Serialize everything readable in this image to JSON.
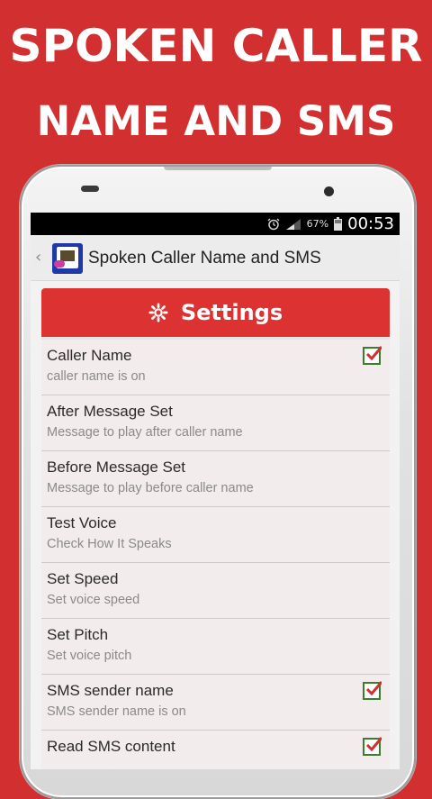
{
  "promo": {
    "line1": "SPOKEN CALLER",
    "line2": "NAME AND SMS"
  },
  "status_bar": {
    "battery_percent": "67%",
    "time": "00:53",
    "icons": [
      "alarm-icon",
      "signal-icon",
      "battery-icon"
    ]
  },
  "action_bar": {
    "back_icon": "chevron-left-icon",
    "title": "Spoken Caller Name and SMS"
  },
  "settings": {
    "header_icon": "gear-icon",
    "title": "Settings",
    "items": [
      {
        "title": "Caller Name",
        "summary": "caller name is on",
        "checked": true
      },
      {
        "title": "After Message Set",
        "summary": "Message to play after caller name",
        "checked": false
      },
      {
        "title": "Before Message Set",
        "summary": "Message to play before caller name",
        "checked": false
      },
      {
        "title": "Test Voice",
        "summary": "Check How It Speaks",
        "checked": false
      },
      {
        "title": "Set Speed",
        "summary": "Set voice speed",
        "checked": false
      },
      {
        "title": "Set Pitch",
        "summary": "Set voice pitch",
        "checked": false
      },
      {
        "title": "SMS sender name",
        "summary": "SMS sender name is on",
        "checked": true
      },
      {
        "title": "Read SMS content",
        "summary": "",
        "checked": true
      }
    ]
  },
  "colors": {
    "accent_red": "#dd3232",
    "background_red": "#d23030",
    "checkbox_green": "#3a7d2a"
  }
}
